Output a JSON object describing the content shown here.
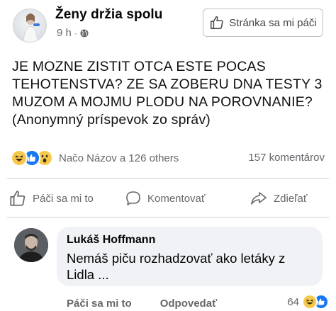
{
  "header": {
    "page_name": "Ženy držia spolu",
    "time": "9 h",
    "separator": "·",
    "like_page_label": "Stránka sa mi páči"
  },
  "post": {
    "lines": [
      "JE MOZNE ZISTIT OTCA ESTE POCAS",
      "TEHOTENSTVA? ZE SA ZOBERU DNA TESTY 3",
      "MUZOM A MOJMU PLODU NA POROVNANIE?",
      "(Anonymný príspevok zo správ)"
    ]
  },
  "reactions": {
    "icons": [
      "haha-icon",
      "like-icon",
      "wow-icon"
    ],
    "names": "Načo Názov a 126 others",
    "comment_count": "157 komentárov"
  },
  "actions": {
    "like_label": "Páči sa mi to",
    "comment_label": "Komentovať",
    "share_label": "Zdieľať"
  },
  "comment": {
    "author": "Lukáš Hoffmann",
    "lines": [
      "Nemáš piču rozhadzovať ako letáky z",
      "Lidla ..."
    ],
    "like_label": "Páči sa mi to",
    "reply_label": "Odpovedať",
    "reaction_count": "64"
  },
  "colors": {
    "like_blue": "#1877f2",
    "reaction_yellow": "#f7c94b",
    "muted_text": "#65676b",
    "bubble_bg": "#f0f2f5"
  }
}
